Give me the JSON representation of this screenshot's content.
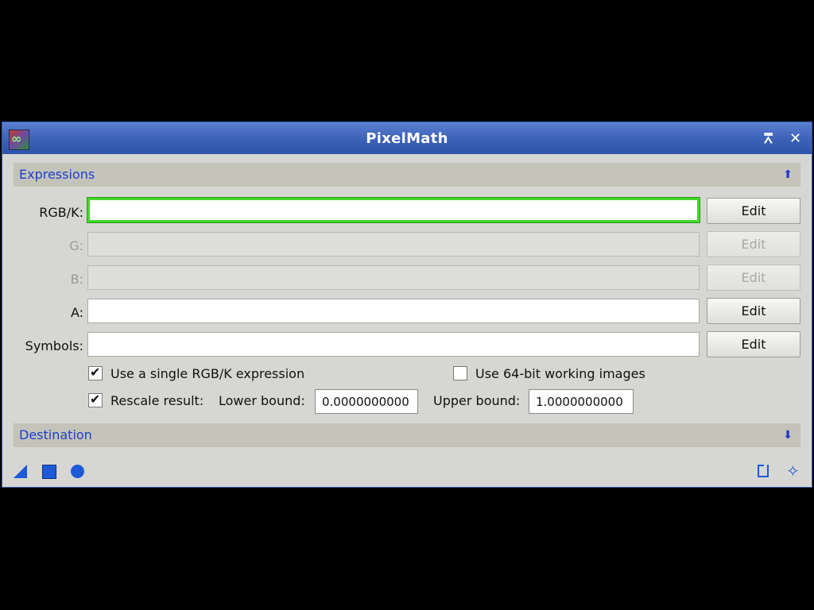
{
  "window": {
    "title": "PixelMath",
    "shade_glyph": "⩞",
    "close_glyph": "✕"
  },
  "expressions": {
    "section_label": "Expressions",
    "collapse_glyph": "⬆",
    "rows": [
      {
        "label": "RGB/K:",
        "value": "",
        "edit_label": "Edit",
        "enabled": true,
        "focused": true
      },
      {
        "label": "G:",
        "value": "",
        "edit_label": "Edit",
        "enabled": false
      },
      {
        "label": "B:",
        "value": "",
        "edit_label": "Edit",
        "enabled": false
      },
      {
        "label": "A:",
        "value": "",
        "edit_label": "Edit",
        "enabled": true
      },
      {
        "label": "Symbols:",
        "value": "",
        "edit_label": "Edit",
        "enabled": true
      }
    ],
    "single_expression": {
      "label": "Use a single RGB/K expression",
      "checked": true
    },
    "use_64bit": {
      "label": "Use 64-bit working images",
      "checked": false
    },
    "rescale": {
      "label": "Rescale result:",
      "checked": true
    },
    "lower_bound": {
      "label": "Lower bound:",
      "value": "0.0000000000"
    },
    "upper_bound": {
      "label": "Upper bound:",
      "value": "1.0000000000"
    },
    "check_glyph": "✔"
  },
  "destination": {
    "section_label": "Destination",
    "expand_glyph": "⬇"
  },
  "bottom_icons": [
    "new-instance-icon",
    "apply-global-icon",
    "apply-icon",
    "edit-instance-icon",
    "reset-icon"
  ],
  "colors": {
    "title_bar": "#3b61b8",
    "section_text": "#1f3ec8",
    "focus_ring": "#44d82c",
    "icon_blue": "#1e5ad8"
  }
}
